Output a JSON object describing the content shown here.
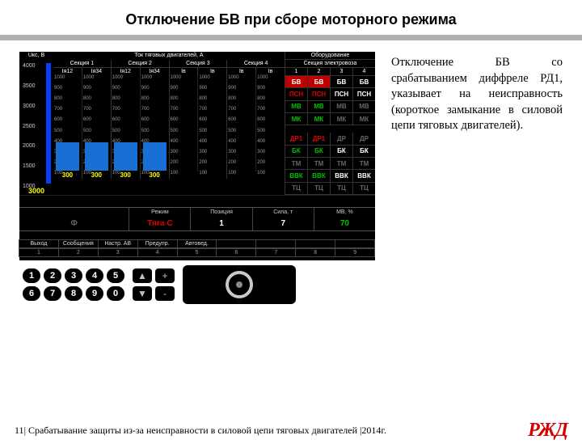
{
  "title": "Отключение БВ при сборе моторного режима",
  "description": "Отключение БВ со срабатыванием диффреле РД1, указывает на неисправность (короткое замыкание в силовой цепи тяговых двигателей).",
  "footer": {
    "page_num": "11",
    "text": "Срабатывание защиты из-за неисправности в силовой цепи тяговых двигателей",
    "year": "2014г.",
    "logo": "РЖД"
  },
  "panel": {
    "left_gauge": {
      "title": "Uкс, В",
      "ticks": [
        "4000",
        "3500",
        "3000",
        "2500",
        "2000",
        "1500",
        "1000"
      ],
      "value": "3000"
    },
    "center": {
      "title": "Ток тяговых двигателей, А",
      "scale_ticks": [
        "1000",
        "900",
        "800",
        "700",
        "600",
        "500",
        "400",
        "300",
        "200",
        "100"
      ],
      "sections": [
        {
          "title": "Секция 1",
          "heads": [
            "Iя12",
            "Iя34"
          ],
          "values": [
            "300",
            "300"
          ],
          "bar_pct": [
            30,
            30
          ]
        },
        {
          "title": "Секция 2",
          "heads": [
            "Iя12",
            "Iя34"
          ],
          "values": [
            "300",
            "300"
          ],
          "bar_pct": [
            30,
            30
          ]
        },
        {
          "title": "Секция 3",
          "heads": [
            "Iв",
            "Iв"
          ],
          "values": [
            "",
            ""
          ],
          "bar_pct": [
            0,
            0
          ]
        },
        {
          "title": "Секция 4",
          "heads": [
            "Iв",
            "Iв"
          ],
          "values": [
            "",
            ""
          ],
          "bar_pct": [
            0,
            0
          ]
        }
      ]
    },
    "equip": {
      "title": "Оборудование",
      "subtitle": "Секция электровоза",
      "heads": [
        "1",
        "2",
        "3",
        "4"
      ],
      "rows": [
        {
          "cells": [
            {
              "t": "БВ",
              "cls": "bg-red"
            },
            {
              "t": "БВ",
              "cls": "bg-red"
            },
            {
              "t": "БВ",
              "cls": "c-white"
            },
            {
              "t": "БВ",
              "cls": "c-white"
            }
          ]
        },
        {
          "cells": [
            {
              "t": "ПСН",
              "cls": "c-red"
            },
            {
              "t": "ПСН",
              "cls": "c-red"
            },
            {
              "t": "ПСН",
              "cls": "c-white"
            },
            {
              "t": "ПСН",
              "cls": "c-white"
            }
          ]
        },
        {
          "cells": [
            {
              "t": "МВ",
              "cls": "c-green"
            },
            {
              "t": "МВ",
              "cls": "c-green"
            },
            {
              "t": "МВ",
              "cls": "c-grey"
            },
            {
              "t": "МВ",
              "cls": "c-grey"
            }
          ]
        },
        {
          "cells": [
            {
              "t": "МК",
              "cls": "c-green"
            },
            {
              "t": "МК",
              "cls": "c-green"
            },
            {
              "t": "МК",
              "cls": "c-grey"
            },
            {
              "t": "МК",
              "cls": "c-grey"
            }
          ]
        },
        {
          "spacer": true
        },
        {
          "cells": [
            {
              "t": "ДР1",
              "cls": "c-red"
            },
            {
              "t": "ДР1",
              "cls": "c-red"
            },
            {
              "t": "ДР",
              "cls": "c-grey"
            },
            {
              "t": "ДР",
              "cls": "c-grey"
            }
          ]
        },
        {
          "cells": [
            {
              "t": "БК",
              "cls": "c-green"
            },
            {
              "t": "БК",
              "cls": "c-green"
            },
            {
              "t": "БК",
              "cls": "c-white"
            },
            {
              "t": "БК",
              "cls": "c-white"
            }
          ]
        },
        {
          "cells": [
            {
              "t": "ТМ",
              "cls": "c-grey"
            },
            {
              "t": "ТМ",
              "cls": "c-grey"
            },
            {
              "t": "ТМ",
              "cls": "c-grey"
            },
            {
              "t": "ТМ",
              "cls": "c-grey"
            }
          ]
        },
        {
          "cells": [
            {
              "t": "ВВК",
              "cls": "c-green"
            },
            {
              "t": "ВВК",
              "cls": "c-green"
            },
            {
              "t": "ВВК",
              "cls": "c-white"
            },
            {
              "t": "ВВК",
              "cls": "c-white"
            }
          ]
        },
        {
          "cells": [
            {
              "t": "ТЦ",
              "cls": "c-grey"
            },
            {
              "t": "ТЦ",
              "cls": "c-grey"
            },
            {
              "t": "ТЦ",
              "cls": "c-grey"
            },
            {
              "t": "ТЦ",
              "cls": "c-grey"
            }
          ]
        }
      ]
    },
    "status": {
      "headers": [
        "",
        "Режим",
        "Позиция",
        "Сила, т",
        "МВ, %"
      ],
      "values": [
        "Ф",
        "Тяга С",
        "1",
        "7",
        "70"
      ],
      "styles": [
        "c-grey",
        "c-red",
        "c-white",
        "c-white",
        "c-green"
      ]
    },
    "menu": {
      "labels": [
        "Выход",
        "Сообщения",
        "Настр. АВ",
        "Предупр.",
        "Автовед.",
        "",
        "",
        "",
        ""
      ],
      "nums": [
        "1",
        "2",
        "3",
        "4",
        "5",
        "6",
        "7",
        "8",
        "9"
      ]
    },
    "keyboard": {
      "row1": [
        "1",
        "2",
        "3",
        "4",
        "5"
      ],
      "row2": [
        "6",
        "7",
        "8",
        "9",
        "0"
      ],
      "side": [
        "▲",
        "+",
        "▼",
        "-"
      ]
    }
  }
}
